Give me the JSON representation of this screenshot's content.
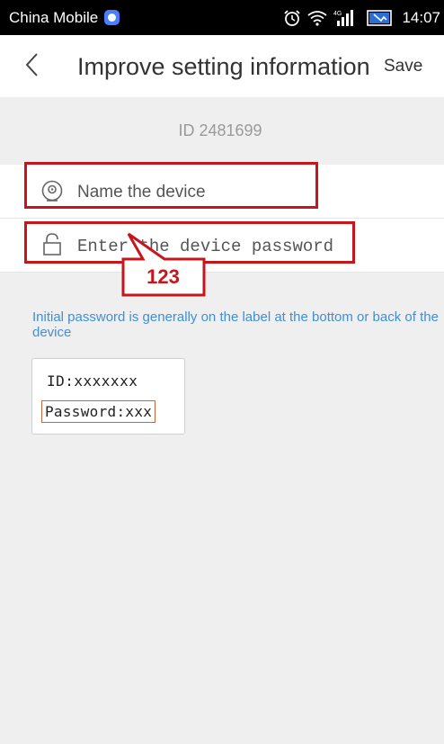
{
  "status_bar": {
    "carrier": "China Mobile",
    "network": "4G",
    "time": "14:07",
    "icons": [
      "alarm-icon",
      "wifi-icon",
      "signal-icon",
      "battery-charging-icon"
    ]
  },
  "header": {
    "back_icon": "chevron-left-icon",
    "title": "Improve setting information",
    "save_label": "Save"
  },
  "device": {
    "id_label": "ID 2481699"
  },
  "form": {
    "name": {
      "icon": "camera-icon",
      "placeholder": "Name the device",
      "value": ""
    },
    "password": {
      "icon": "lock-icon",
      "placeholder": "Enter the device password",
      "value": ""
    }
  },
  "annotation": {
    "callout_text": "123",
    "color": "#c4161c"
  },
  "hint": {
    "text": "Initial password is generally on the label at the bottom or back of the device",
    "color": "#3f8fd8"
  },
  "device_label": {
    "id_line": "ID:xxxxxxx",
    "password_line": "Password:xxx"
  },
  "colors": {
    "background_gray": "#efefef",
    "text_dark": "#333333",
    "text_muted": "#9a9a9a"
  }
}
